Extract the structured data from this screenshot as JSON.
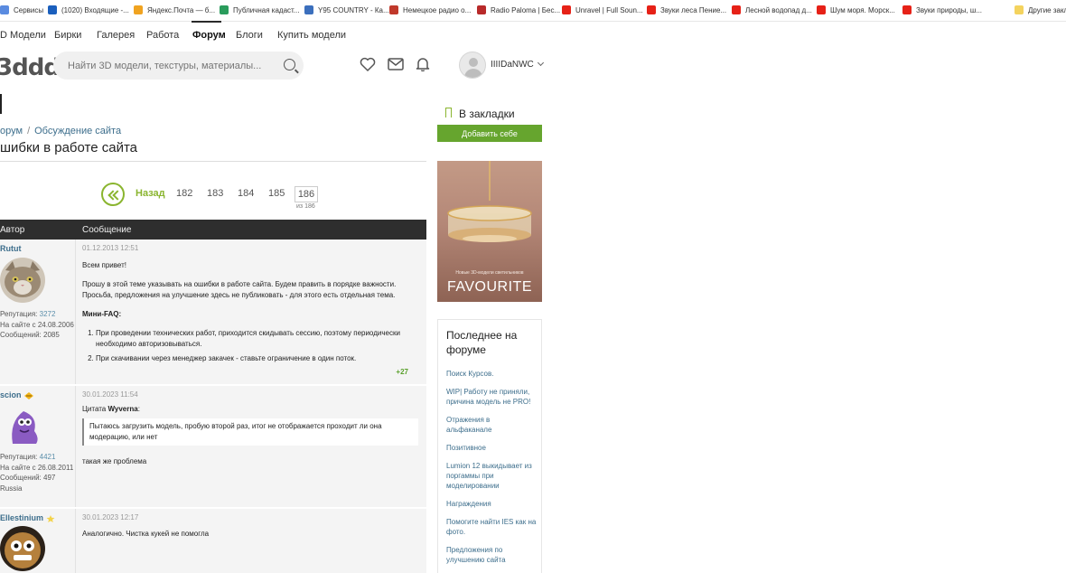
{
  "bookmarks": [
    {
      "label": "Сервисы",
      "color": "#5a8be0"
    },
    {
      "label": "(1020) Входящие -...",
      "color": "#1a5fbd"
    },
    {
      "label": "Яндекс.Почта — б...",
      "color": "#f0a320"
    },
    {
      "label": "Публичная кадаст...",
      "color": "#2a9c5c"
    },
    {
      "label": "Y95 COUNTRY - Ка...",
      "color": "#3b6fbd"
    },
    {
      "label": "Немецкое радио о...",
      "color": "#c0392b"
    },
    {
      "label": "Radio Paloma | Бес...",
      "color": "#b82a2a"
    },
    {
      "label": "Unravel | Full Soun...",
      "color": "#e62117"
    },
    {
      "label": "Звуки леса Пение...",
      "color": "#e62117"
    },
    {
      "label": "Лесной водопад д...",
      "color": "#e62117"
    },
    {
      "label": "Шум моря. Морск...",
      "color": "#e62117"
    },
    {
      "label": "Звуки природы, ш...",
      "color": "#e62117"
    },
    {
      "label": "Другие закл",
      "color": "#f4d35e"
    }
  ],
  "nav": {
    "items": [
      "D Модели",
      "Бирки",
      "Галерея",
      "Работа",
      "Форум",
      "Блоги",
      "Купить модели"
    ],
    "active": "Форум"
  },
  "header": {
    "logo": "3ddd",
    "search_placeholder": "Найти 3D модели, текстуры, материалы...",
    "username": "IIIIDaNWC"
  },
  "breadcrumb": {
    "parent": "орум",
    "current": "Обсуждение сайта"
  },
  "page_title": "шибки в работе сайта",
  "pagination": {
    "back_label": "Назад",
    "pages": [
      "182",
      "183",
      "184",
      "185"
    ],
    "current": "186",
    "of_label": "из 186"
  },
  "table": {
    "col_author": "Автор",
    "col_message": "Сообщение"
  },
  "posts": [
    {
      "author": "Rutut",
      "reputation_label": "Репутация: ",
      "reputation": "3272",
      "since": "На сайте с 24.08.2006",
      "messages": "Сообщений: 2085",
      "date": "01.12.2013 12:51",
      "greeting": "Всем привет!",
      "para1": "Прошу в этой теме указывать на ошибки в работе сайта. Будем править в порядке важности. Просьба, предложения на улучшение здесь не публиковать - для этого есть отдельная тема.",
      "faq_title": "Мини-FAQ:",
      "faq": [
        "При проведении технических работ, приходится скидывать сессию, поэтому периодически необходимо авторизовываться.",
        "При скачивании через менеджер закачек - ставьте ограничение в один поток."
      ],
      "likes": "+27"
    },
    {
      "author": "scion",
      "reputation_label": "Репутация: ",
      "reputation": "4421",
      "since": "На сайте с 26.08.2011",
      "messages": "Сообщений: 497",
      "country": "Russia",
      "date": "30.01.2023 11:54",
      "quote_prefix": "Цитата ",
      "quote_author": "Wyverna",
      "quote_suffix": ":",
      "quote_text": "Пытаюсь загрузить модель, пробую второй раз, итог не отображается  проходит ли она модерацию, или нет",
      "text": "такая же проблема"
    },
    {
      "author": "Ellestinium",
      "date": "30.01.2023 12:17",
      "text": "Аналогично. Чистка кукей не помогла"
    }
  ],
  "sidebar": {
    "bookmarks_title": "В закладки",
    "add_button": "Добавить себе",
    "ad_small": "Новые 3D-модели светильников",
    "ad_big": "FAVOURITE",
    "forum_title": "Последнее на форуме",
    "forum_links": [
      "Поиск Курсов.",
      "WIP| Работу не приняли, причина модель не PRO!",
      "Отражения в альфаканале",
      "Позитивное",
      "Lumion 12 выкидывает из поргаммы при моделировании",
      "Награждения",
      "Помогите найти IES как на фото.",
      "Предложения по улучшению сайта"
    ]
  },
  "colors": {
    "accent": "#8ab52f",
    "button": "#66a52e",
    "link": "#3d6e8c",
    "header_dark": "#2e2e2e"
  }
}
